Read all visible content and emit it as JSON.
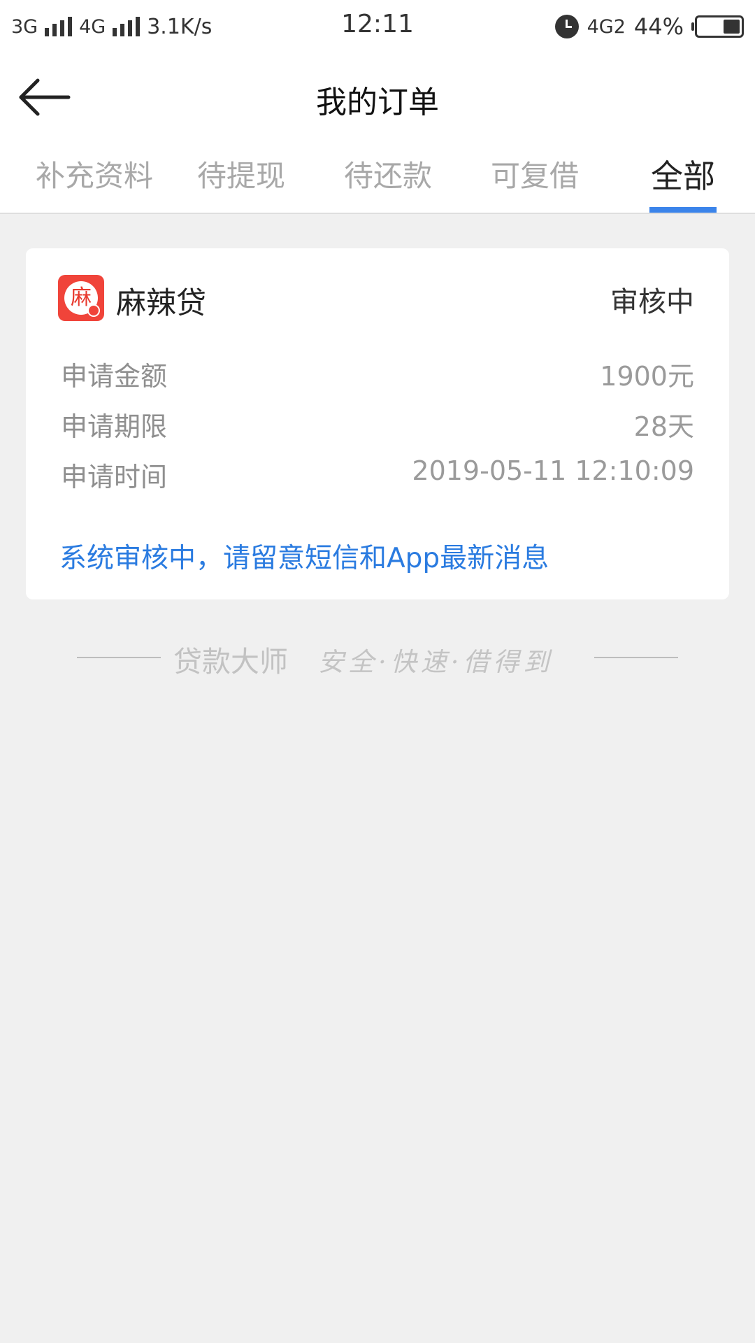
{
  "status_bar": {
    "network1": "3G",
    "network2": "4G",
    "speed": "3.1K/s",
    "time": "12:11",
    "data_network": "4G2",
    "battery_percent": "44%",
    "battery_level": 0.44
  },
  "header": {
    "title": "我的订单",
    "back_icon": "arrow-left-icon"
  },
  "tabs": [
    {
      "label": "补充资料",
      "active": false
    },
    {
      "label": "待提现",
      "active": false
    },
    {
      "label": "待还款",
      "active": false
    },
    {
      "label": "可复借",
      "active": false
    },
    {
      "label": "全部",
      "active": true
    }
  ],
  "order": {
    "product_logo_char": "麻",
    "product_name": "麻辣贷",
    "status": "审核中",
    "rows": [
      {
        "label": "申请金额",
        "value": "1900元"
      },
      {
        "label": "申请期限",
        "value": "28天"
      },
      {
        "label": "申请时间",
        "value": "2019-05-11 12:10:09"
      }
    ],
    "notice": "系统审核中，请留意短信和App最新消息"
  },
  "footer": {
    "brand": "贷款大师",
    "slogan": "安全·快速·借得到"
  },
  "colors": {
    "accent_blue": "#3b84ea",
    "notice_blue": "#2a7be0",
    "logo_red": "#f0443a",
    "background": "#f0f0f0"
  }
}
